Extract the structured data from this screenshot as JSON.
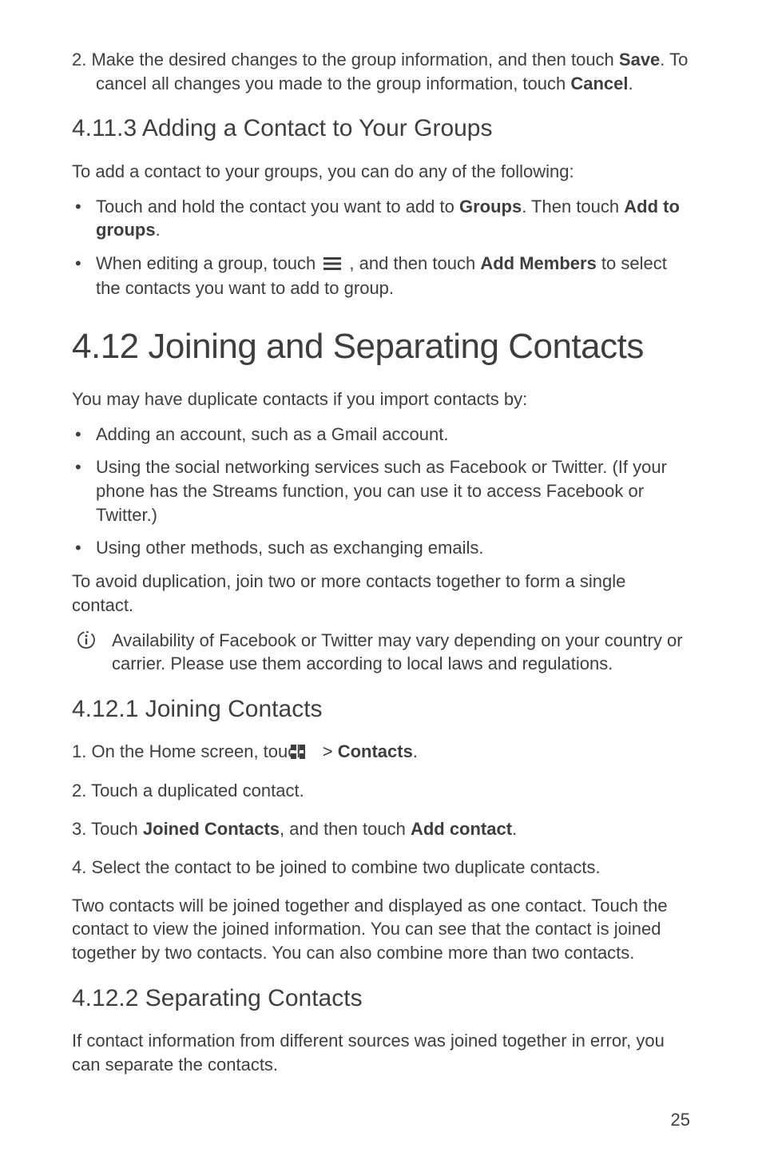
{
  "section_4_11": {
    "step2_prefix": "2. ",
    "step2_text_a": "Make the desired changes to the group information, and then touch ",
    "step2_bold_a": "Save",
    "step2_text_b": ". To cancel all changes you made to the group information, touch ",
    "step2_bold_b": "Cancel",
    "step2_text_c": ".",
    "h_4_11_3": "4.11.3  Adding a Contact to Your Groups",
    "intro_4_11_3": "To add a contact to your groups, you can do any of the following:",
    "bullet1_a": "Touch and hold the contact you want to add to ",
    "bullet1_bold_a": "Groups",
    "bullet1_b": ". Then touch ",
    "bullet1_bold_b": "Add to groups",
    "bullet1_c": ".",
    "bullet2_a": "When editing a group, touch ",
    "bullet2_b": " , and then touch ",
    "bullet2_bold": "Add Members",
    "bullet2_c": " to select the contacts you want to add to group."
  },
  "section_4_12": {
    "h1": "4.12  Joining and Separating Contacts",
    "intro": "You may have duplicate contacts if you import contacts by:",
    "b1": "Adding an account, such as a Gmail account.",
    "b2": "Using the social networking services such as Facebook or Twitter. (If your phone has the Streams function, you can use it to access Facebook or Twitter.)",
    "b3": "Using other methods, such as exchanging emails.",
    "after_bullets": "To avoid duplication, join two or more contacts together to form a single contact.",
    "note": "Availability of Facebook or Twitter may vary depending on your country or carrier. Please use them according to local laws and regulations.",
    "h_4_12_1": "4.12.1  Joining Contacts",
    "s1_prefix": "1. ",
    "s1_a": "On the Home screen, touch ",
    "s1_b": "  > ",
    "s1_bold": "Contacts",
    "s1_c": ".",
    "s2_prefix": "2. ",
    "s2": "Touch a duplicated contact.",
    "s3_prefix": "3. ",
    "s3_a": "Touch ",
    "s3_bold_a": "Joined Contacts",
    "s3_b": ", and then touch ",
    "s3_bold_b": "Add contact",
    "s3_c": ".",
    "s4_prefix": "4. ",
    "s4": "Select the contact to be joined to combine two duplicate contacts.",
    "after_steps": "Two contacts will be joined together and displayed as one contact. Touch the contact to view the joined information. You can see that the contact is joined together by two contacts. You can also combine more than two contacts.",
    "h_4_12_2": "4.12.2  Separating Contacts",
    "sep_intro": "If contact information from different sources was joined together in error, you can separate the contacts."
  },
  "page_number": "25"
}
